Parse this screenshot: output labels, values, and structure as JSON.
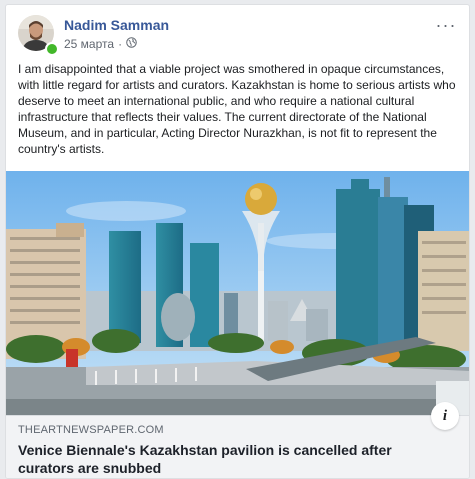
{
  "post": {
    "author": "Nadim Samman",
    "date": "25 марта",
    "separator": "·",
    "privacy_icon": "globe-icon",
    "menu_label": "···",
    "text": "I am disappointed that a viable project was smothered in opaque circumstances, with little regard for artists and curators. Kazakhstan is home to serious artists who deserve to meet an international public, and who require a national cultural infrastructure that reflects their values. The current directorate of the National Museum, and in particular, Acting Director Nurazkhan, is not fit to represent the country's artists."
  },
  "link": {
    "domain": "THEARTNEWSPAPER.COM",
    "title": "Venice Biennale's Kazakhstan pavilion is cancelled after curators are snubbed",
    "info_label": "i"
  },
  "colors": {
    "author": "#385898",
    "online": "#42b72a",
    "sky": "#8cc6f2"
  }
}
